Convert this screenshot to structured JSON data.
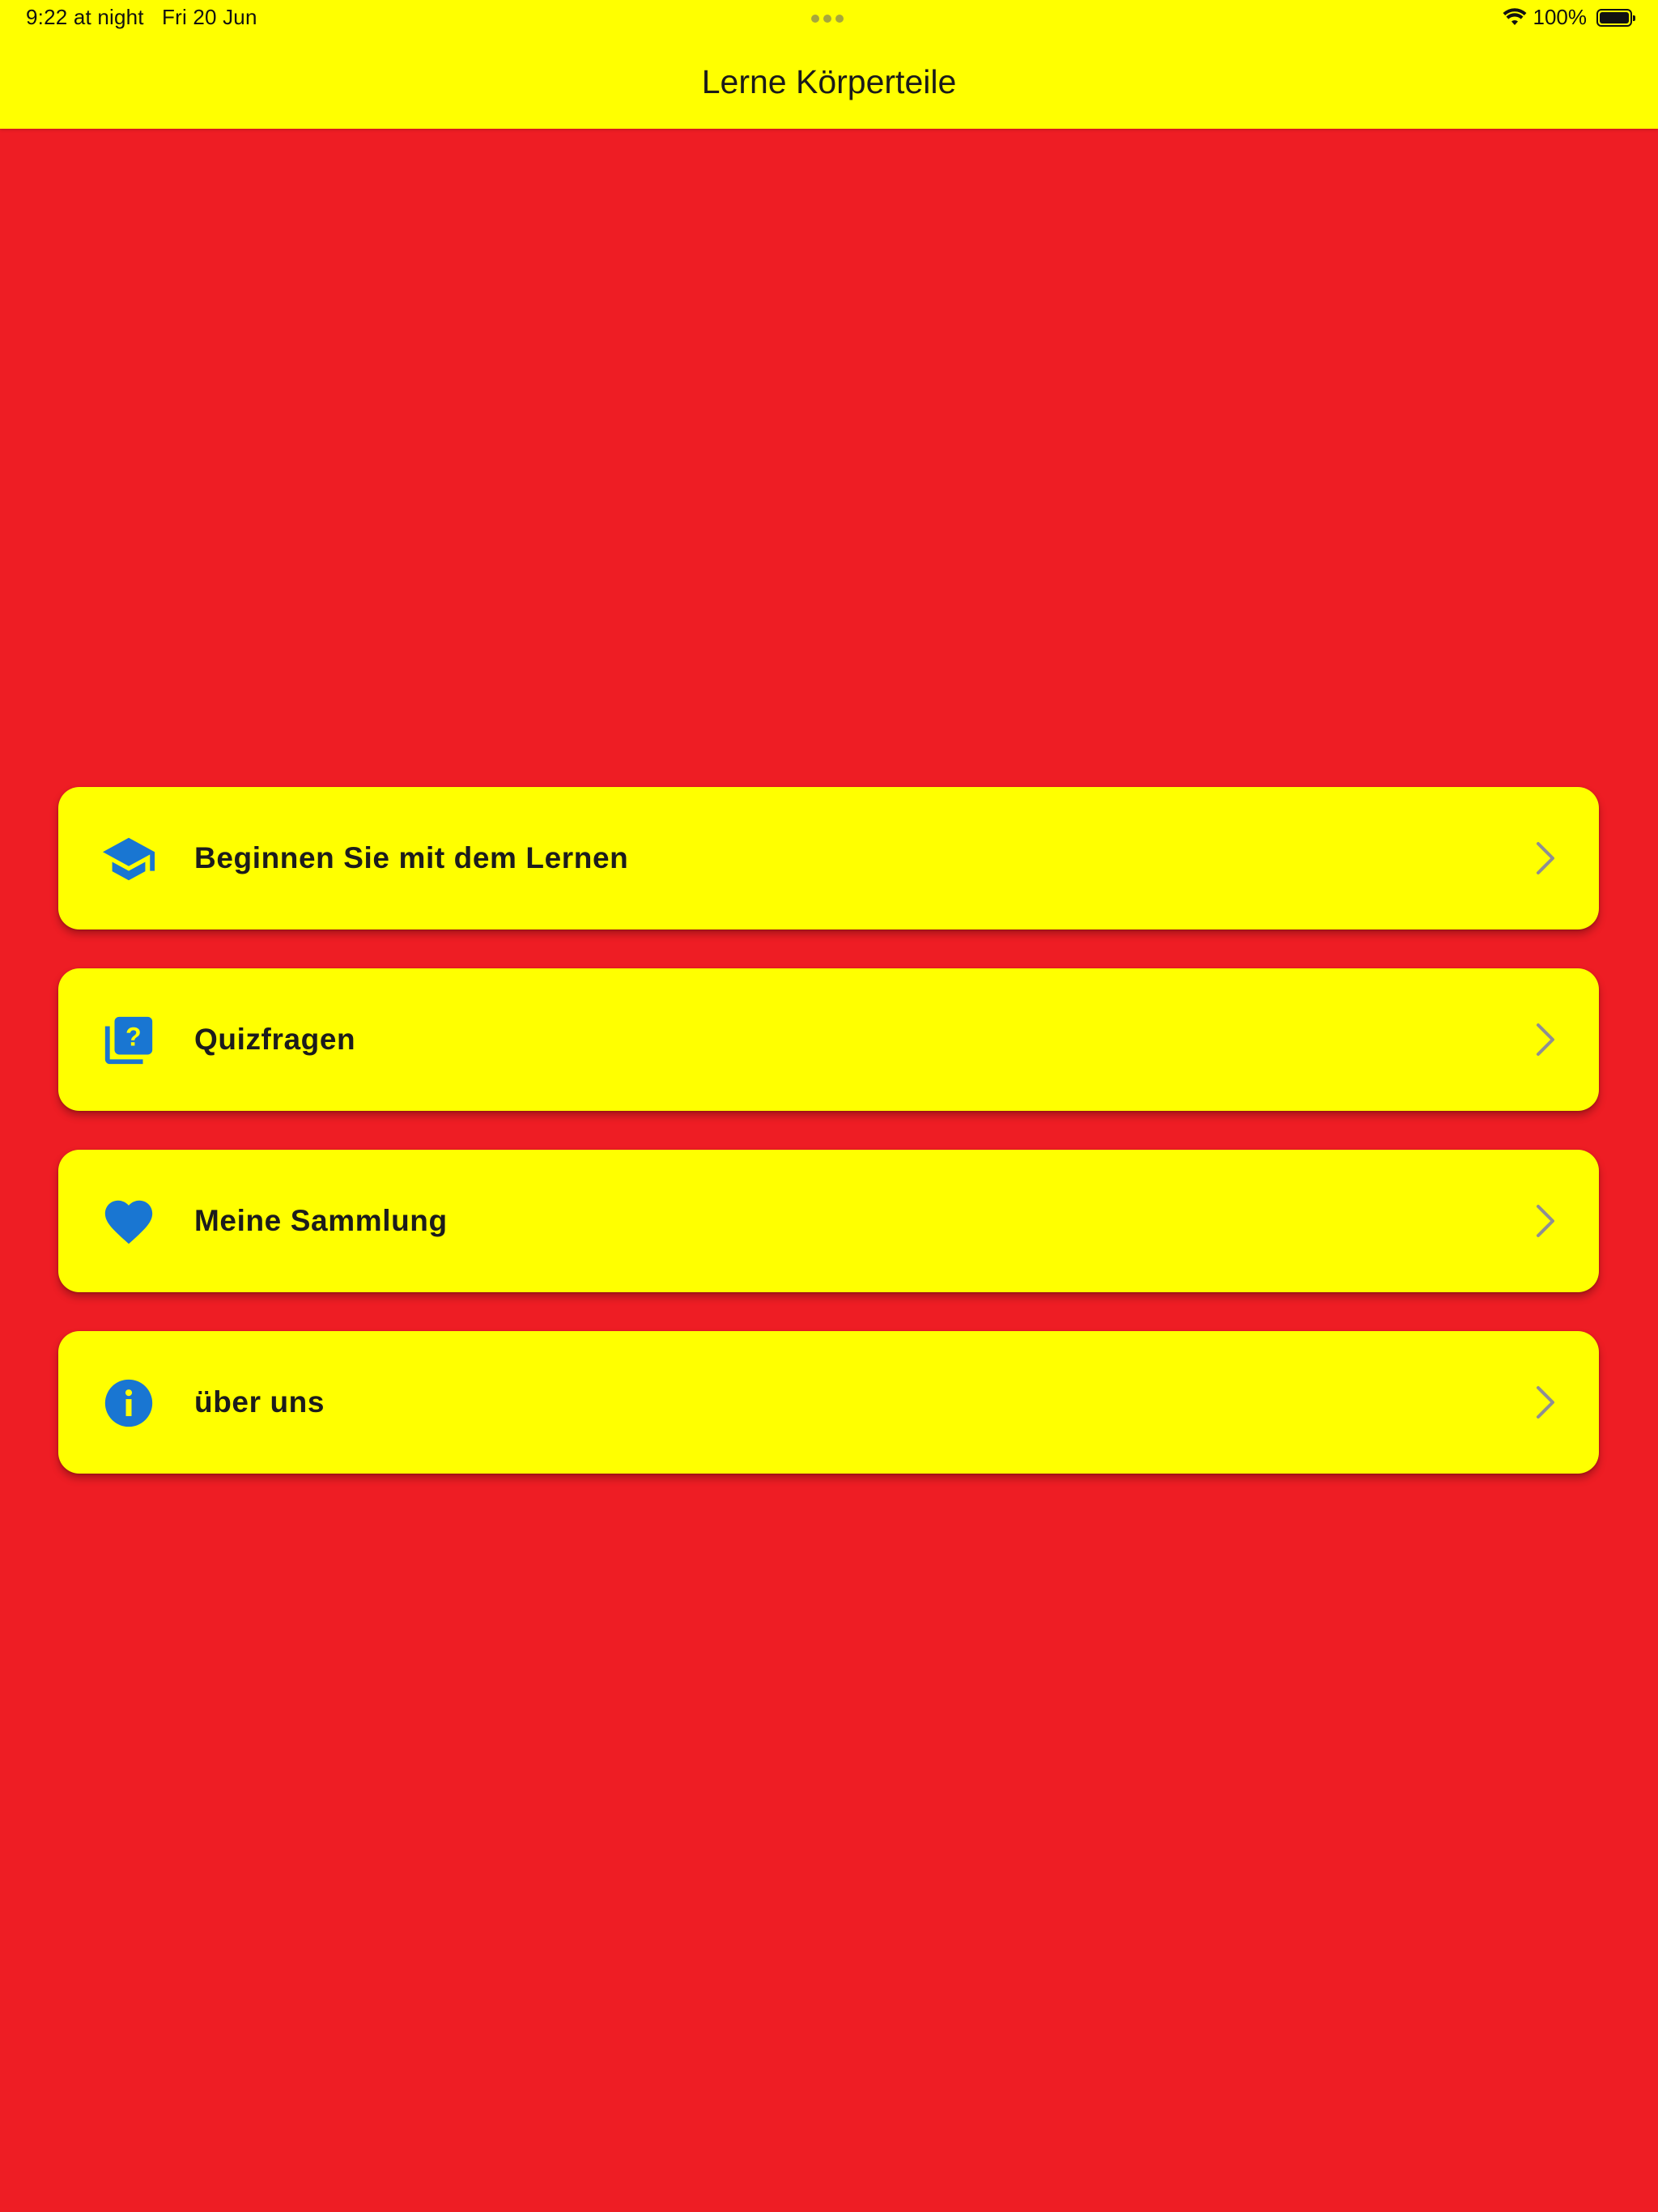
{
  "status_bar": {
    "time": "9:22 at night",
    "date": "Fri 20 Jun",
    "battery": "100%"
  },
  "header": {
    "title": "Lerne Körperteile"
  },
  "menu": {
    "items": [
      {
        "label": "Beginnen Sie mit dem Lernen",
        "icon": "graduation-cap-icon"
      },
      {
        "label": "Quizfragen",
        "icon": "quiz-icon"
      },
      {
        "label": "Meine Sammlung",
        "icon": "heart-icon"
      },
      {
        "label": "über uns",
        "icon": "info-icon"
      }
    ]
  },
  "colors": {
    "background": "#EE1D24",
    "header_bg": "#FFFF00",
    "card_bg": "#FFFF00",
    "icon": "#1976D2",
    "chevron": "#8E8E93"
  }
}
